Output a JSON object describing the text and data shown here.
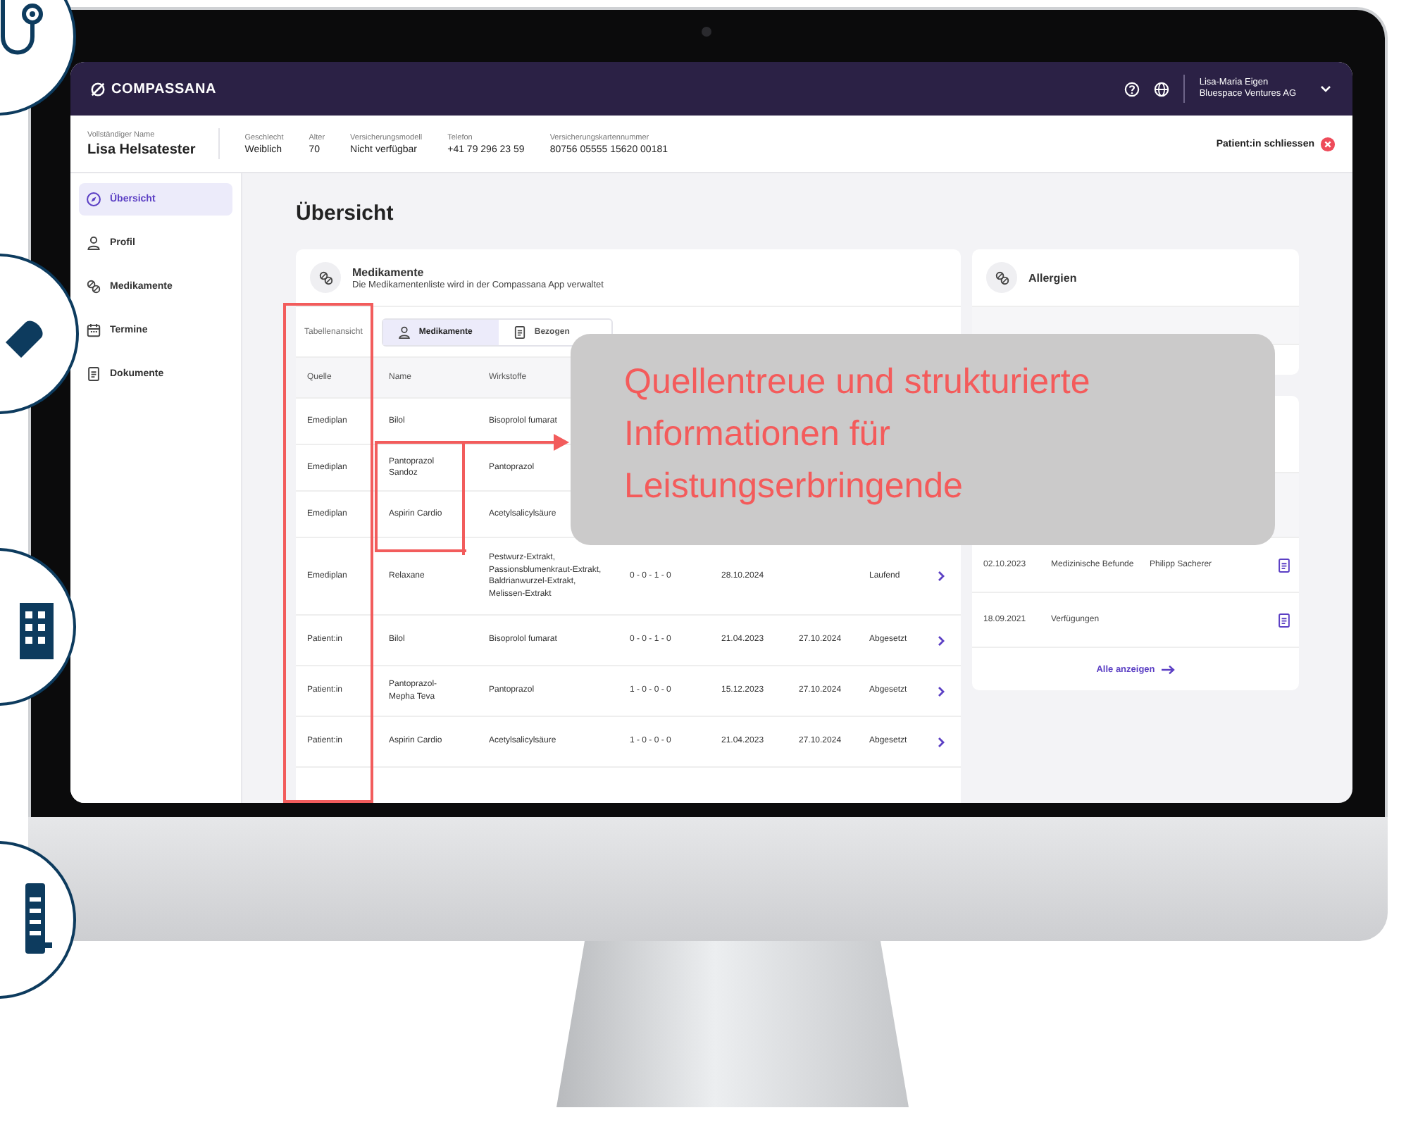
{
  "topbar": {
    "logo": "COMPASSANA",
    "user_name": "Lisa-Maria Eigen",
    "user_org": "Bluespace Ventures AG"
  },
  "patient": {
    "fields": [
      {
        "label": "Vollständiger Name",
        "value": "Lisa Helsatester"
      },
      {
        "label": "Geschlecht",
        "value": "Weiblich"
      },
      {
        "label": "Alter",
        "value": "70"
      },
      {
        "label": "Versicherungsmodell",
        "value": "Nicht verfügbar"
      },
      {
        "label": "Telefon",
        "value": "+41 79 296 23 59"
      },
      {
        "label": "Versicherungskartennummer",
        "value": "80756 05555 15620 00181"
      }
    ],
    "close_label": "Patient:in schliessen"
  },
  "sidebar": {
    "items": [
      {
        "label": "Übersicht",
        "kind": "compass",
        "selected": true
      },
      {
        "label": "Profil",
        "kind": "person",
        "selected": false
      },
      {
        "label": "Medikamente",
        "kind": "pills",
        "selected": false
      },
      {
        "label": "Termine",
        "kind": "calendar",
        "selected": false
      },
      {
        "label": "Dokumente",
        "kind": "document",
        "selected": false
      }
    ]
  },
  "page_title": "Übersicht",
  "medications": {
    "title": "Medikamente",
    "subtitle": "Die Medikamentenliste wird in der Compassana App verwaltet",
    "view_label": "Tabellenansicht",
    "tabs": [
      {
        "label": "Medikamente",
        "kind": "person",
        "selected": true
      },
      {
        "label": "Bezogen",
        "kind": "document",
        "selected": false
      }
    ],
    "columns": [
      "Quelle",
      "Name",
      "Wirkstoffe"
    ],
    "rows": [
      {
        "column_1": "Emediplan",
        "column_2": "Bilol",
        "column_3": "Bisoprolol fumarat"
      },
      {
        "column_1": "Emediplan",
        "column_2": "Pantoprazol Sandoz",
        "column_3": "Pantoprazol"
      },
      {
        "column_1": "Emediplan",
        "column_2": "Aspirin Cardio",
        "column_3": "Acetylsalicylsäure"
      },
      {
        "column_1": "Emediplan",
        "column_2": "Relaxane",
        "column_3": "Pestwurz-Extrakt, Passionsblumenkraut-Extrakt, Baldrianwurzel-Extrakt, Melissen-Extrakt",
        "column_4": "0 - 0 - 1 - 0",
        "column_5": "28.10.2024",
        "column_7": "Laufend"
      },
      {
        "column_1": "Patient:in",
        "column_2": "Bilol",
        "column_3": "Bisoprolol fumarat",
        "column_4": "0 - 0 - 1 - 0",
        "column_5": "21.04.2023",
        "column_6": "27.10.2024",
        "column_7": "Abgesetzt"
      },
      {
        "column_1": "Patient:in",
        "column_2": "Pantoprazol-Mepha Teva",
        "column_3": "Pantoprazol",
        "column_4": "1 - 0 - 0 - 0",
        "column_5": "15.12.2023",
        "column_6": "27.10.2024",
        "column_7": "Abgesetzt"
      },
      {
        "column_1": "Patient:in",
        "column_2": "Aspirin Cardio",
        "column_3": "Acetylsalicylsäure",
        "column_4": "1 - 0 - 0 - 0",
        "column_5": "21.04.2023",
        "column_6": "27.10.2024",
        "column_7": "Abgesetzt"
      }
    ]
  },
  "allergies": {
    "title": "Allergien"
  },
  "documents": {
    "rows": [
      {
        "date": "02.10.2023",
        "category": "Medizinische Befunde",
        "author": "Philipp Sacherer"
      },
      {
        "date": "18.09.2021",
        "category": "Verfügungen"
      }
    ],
    "show_all": "Alle anzeigen"
  },
  "callout": {
    "text": "Quellentreue und strukturierte Informationen für Leistungserbringende"
  }
}
